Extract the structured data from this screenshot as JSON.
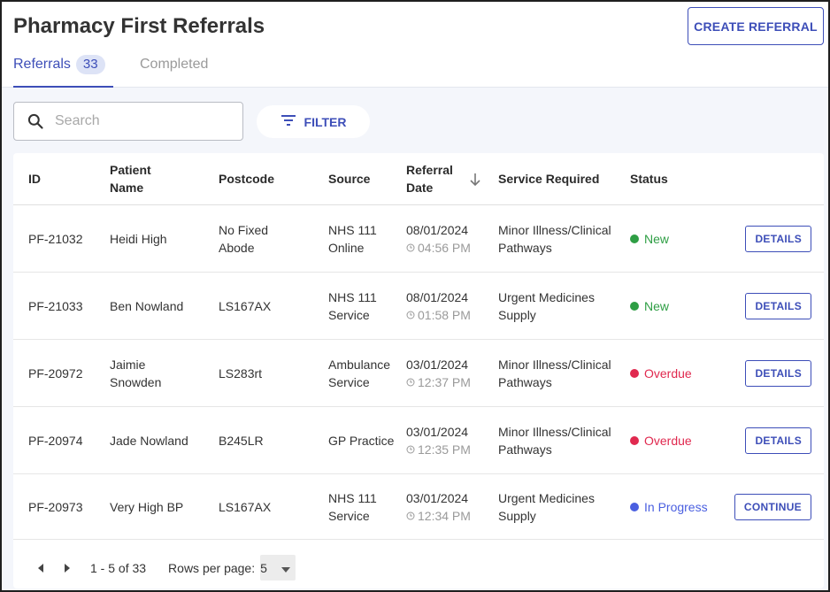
{
  "header": {
    "title": "Pharmacy First Referrals",
    "create_label": "CREATE REFERRAL"
  },
  "tabs": [
    {
      "label": "Referrals",
      "count": "33",
      "active": true
    },
    {
      "label": "Completed",
      "active": false
    }
  ],
  "search": {
    "placeholder": "Search",
    "value": ""
  },
  "filter_label": "FILTER",
  "table": {
    "columns": [
      "ID",
      "Patient Name",
      "Postcode",
      "Source",
      "Referral Date",
      "Service Required",
      "Status"
    ],
    "rows": [
      {
        "id": "PF-21032",
        "patient": "Heidi High",
        "postcode": "No Fixed Abode",
        "source": "NHS 111 Online",
        "date": "08/01/2024",
        "time": "04:56 PM",
        "service": "Minor Illness/Clinical Pathways",
        "status": "New",
        "action": "DETAILS"
      },
      {
        "id": "PF-21033",
        "patient": "Ben Nowland",
        "postcode": "LS167AX",
        "source": "NHS 111 Service",
        "date": "08/01/2024",
        "time": "01:58 PM",
        "service": "Urgent Medicines Supply",
        "status": "New",
        "action": "DETAILS"
      },
      {
        "id": "PF-20972",
        "patient": "Jaimie Snowden",
        "postcode": "LS283rt",
        "source": "Ambulance Service",
        "date": "03/01/2024",
        "time": "12:37 PM",
        "service": "Minor Illness/Clinical Pathways",
        "status": "Overdue",
        "action": "DETAILS"
      },
      {
        "id": "PF-20974",
        "patient": "Jade Nowland",
        "postcode": "B245LR",
        "source": "GP Practice",
        "date": "03/01/2024",
        "time": "12:35 PM",
        "service": "Minor Illness/Clinical Pathways",
        "status": "Overdue",
        "action": "DETAILS"
      },
      {
        "id": "PF-20973",
        "patient": "Very High BP",
        "postcode": "LS167AX",
        "source": "NHS 111 Service",
        "date": "03/01/2024",
        "time": "12:34 PM",
        "service": "Urgent Medicines Supply",
        "status": "In Progress",
        "action": "CONTINUE"
      }
    ]
  },
  "pagination": {
    "range": "1 - 5 of 33",
    "rows_per_page_label": "Rows per page:",
    "rows_per_page_value": "5"
  },
  "colors": {
    "accent": "#3d4eb8",
    "status_new": "#2e9e44",
    "status_overdue": "#e0294f",
    "status_in_progress": "#4a5fe0"
  }
}
